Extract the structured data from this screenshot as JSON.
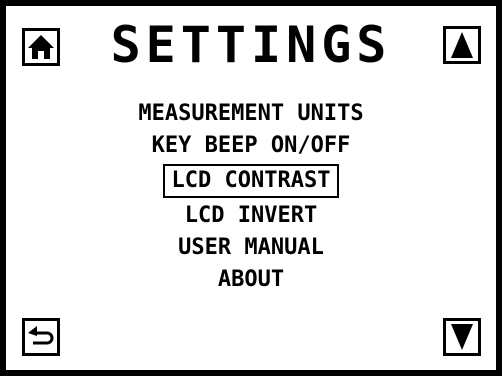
{
  "screen": {
    "title": "SETTINGS",
    "menu_items": [
      {
        "label": "MEASUREMENT UNITS",
        "selected": false
      },
      {
        "label": "KEY BEEP ON/OFF",
        "selected": false
      },
      {
        "label": "LCD CONTRAST",
        "selected": true
      },
      {
        "label": "LCD INVERT",
        "selected": false
      },
      {
        "label": "USER MANUAL",
        "selected": false
      },
      {
        "label": "ABOUT",
        "selected": false
      }
    ]
  },
  "icons": {
    "home": "home-icon",
    "scroll_up": "triangle-up-icon",
    "back": "return-arrow-icon",
    "scroll_down": "triangle-down-icon"
  },
  "colors": {
    "foreground": "#000000",
    "background": "#ffffff"
  }
}
